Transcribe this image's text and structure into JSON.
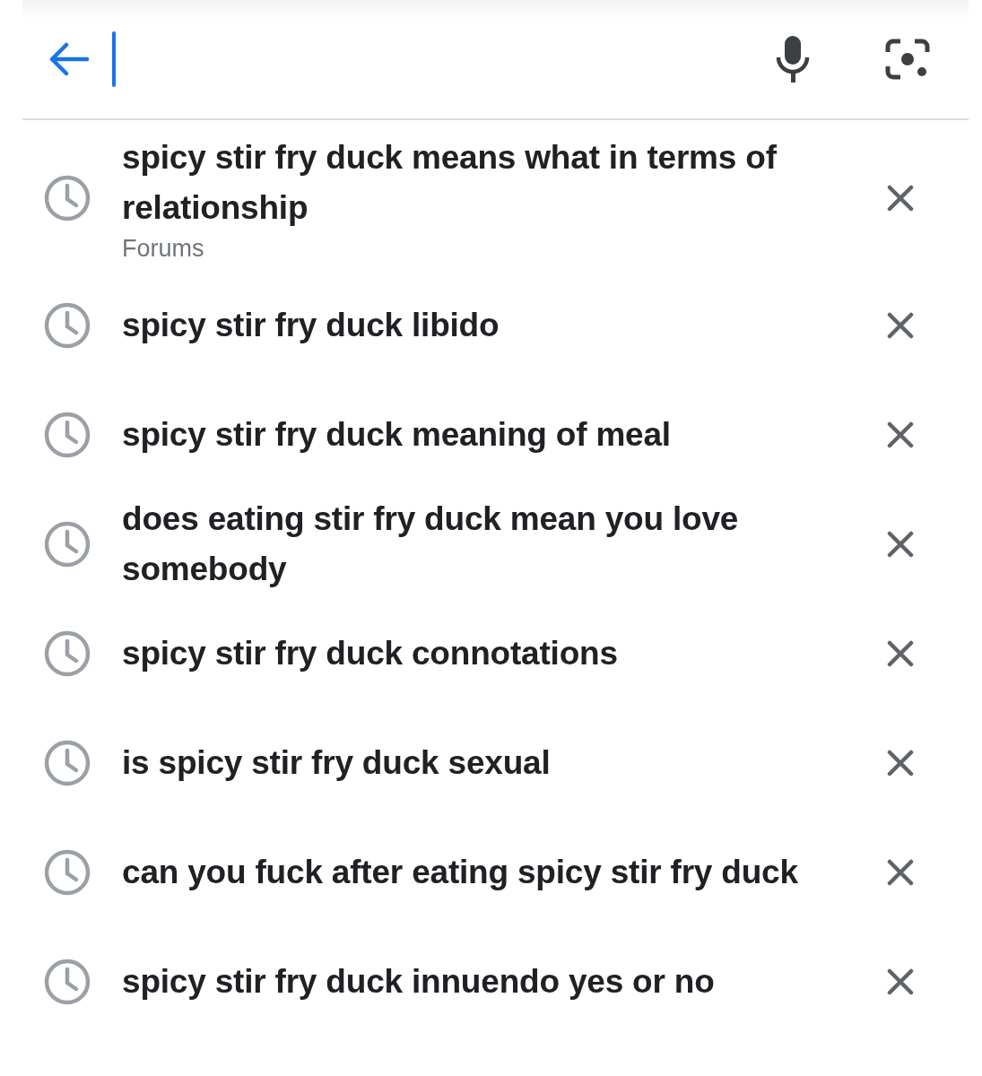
{
  "search_bar": {
    "focused": true
  },
  "suggestions": [
    {
      "text": "spicy stir fry duck means what in terms of relationship",
      "subtitle": "Forums"
    },
    {
      "text": "spicy stir fry duck libido"
    },
    {
      "text": "spicy stir fry duck meaning of meal"
    },
    {
      "text": "does eating stir fry duck mean you love somebody"
    },
    {
      "text": "spicy stir fry duck connotations"
    },
    {
      "text": "is spicy stir fry duck sexual"
    },
    {
      "text": "can you fuck after eating spicy stir fry duck"
    },
    {
      "text": "spicy stir fry duck innuendo yes or no"
    }
  ]
}
